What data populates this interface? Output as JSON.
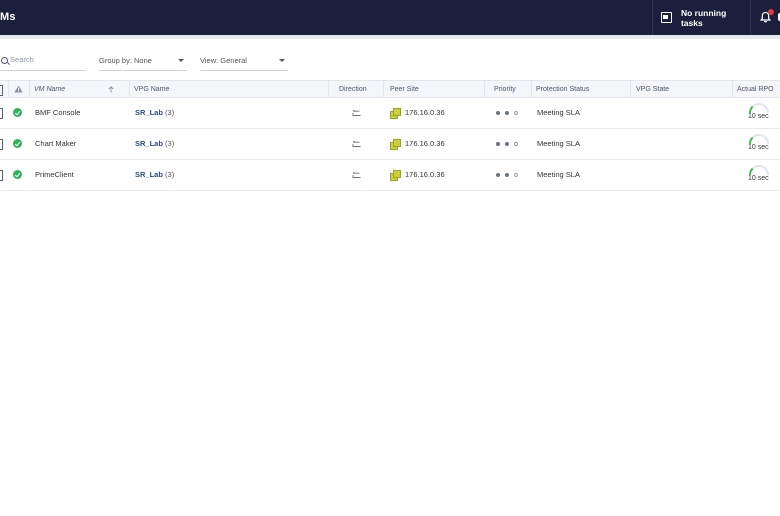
{
  "header": {
    "title": "Ms",
    "tasks_label": "No running tasks"
  },
  "filters": {
    "search_placeholder": "Search",
    "group_by": "Group by: None",
    "view": "View: General"
  },
  "table": {
    "columns": {
      "vm_name": "VM Name",
      "vpg_name": "VPG Name",
      "direction": "Direction",
      "peer_site": "Peer Site",
      "priority": "Priority",
      "protection_status": "Protection Status",
      "vpg_state": "VPG State",
      "actual_rpo": "Actual RPO"
    },
    "rows": [
      {
        "vm_name": "BMF Console",
        "vpg_name": "SR_Lab",
        "vpg_count": "(3)",
        "peer_site": "176.16.0.36",
        "protection_status": "Meeting SLA",
        "rpo": "10 sec"
      },
      {
        "vm_name": "Chart Maker",
        "vpg_name": "SR_Lab",
        "vpg_count": "(3)",
        "peer_site": "176.16.0.36",
        "protection_status": "Meeting SLA",
        "rpo": "10 sec"
      },
      {
        "vm_name": "PrimeClient",
        "vpg_name": "SR_Lab",
        "vpg_count": "(3)",
        "peer_site": "176.16.0.36",
        "protection_status": "Meeting SLA",
        "rpo": "10 sec"
      }
    ]
  },
  "colors": {
    "topbar": "#1b1f3b",
    "ok": "#2db35d",
    "alert": "#e53a3a",
    "link": "#2a4a8a",
    "site": "#c9d23a",
    "rpo_arc": "#3cc04a"
  }
}
